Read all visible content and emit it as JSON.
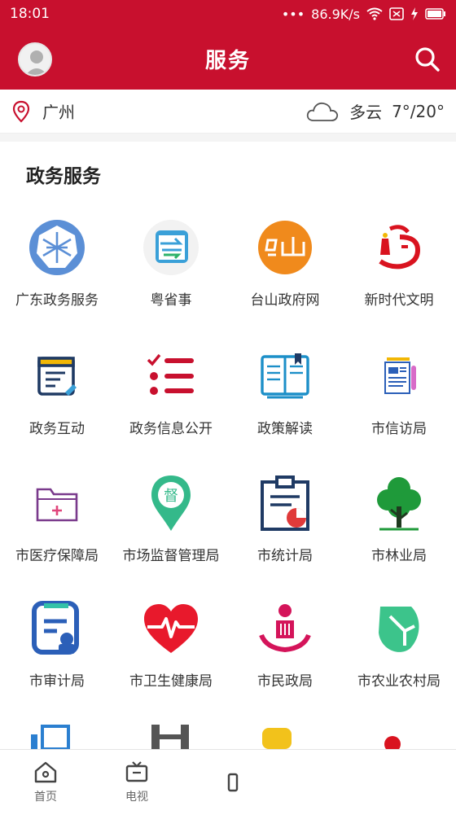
{
  "status_bar": {
    "time": "18:01",
    "network_speed": "86.9K/s"
  },
  "header": {
    "title": "服务"
  },
  "location": {
    "city": "广州",
    "weather": "多云",
    "temperature": "7°/20°"
  },
  "section": {
    "title": "政务服务"
  },
  "services": [
    {
      "label": "广东政务服务",
      "icon": "guangdong-gov-icon"
    },
    {
      "label": "粤省事",
      "icon": "yueshengshi-icon"
    },
    {
      "label": "台山政府网",
      "icon": "taishan-icon"
    },
    {
      "label": "新时代文明",
      "icon": "civilization-icon"
    },
    {
      "label": "政务互动",
      "icon": "interaction-icon"
    },
    {
      "label": "政务信息公开",
      "icon": "info-list-icon"
    },
    {
      "label": "政策解读",
      "icon": "book-icon"
    },
    {
      "label": "市信访局",
      "icon": "petition-icon"
    },
    {
      "label": "市医疗保障局",
      "icon": "folder-plus-icon"
    },
    {
      "label": "市场监督管理局",
      "icon": "supervision-pin-icon"
    },
    {
      "label": "市统计局",
      "icon": "clipboard-chart-icon"
    },
    {
      "label": "市林业局",
      "icon": "tree-icon"
    },
    {
      "label": "市审计局",
      "icon": "audit-icon"
    },
    {
      "label": "市卫生健康局",
      "icon": "heart-pulse-icon"
    },
    {
      "label": "市民政局",
      "icon": "civil-affairs-icon"
    },
    {
      "label": "市农业农村局",
      "icon": "leaf-icon"
    }
  ],
  "tabbar": [
    {
      "label": "首页",
      "icon": "home-icon"
    },
    {
      "label": "电视",
      "icon": "tv-icon"
    }
  ],
  "colors": {
    "brand_red": "#c8102e"
  }
}
